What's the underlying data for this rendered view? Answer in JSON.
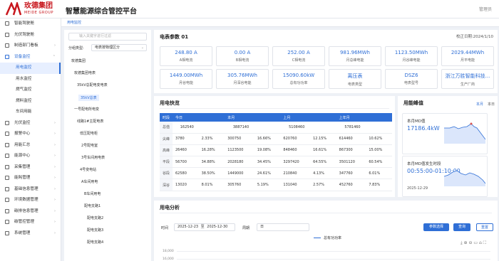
{
  "header": {
    "brand": "玫德集团",
    "brand_sub": "MEIDE GROUP",
    "title": "智慧能源综合管控平台",
    "user": "管理员"
  },
  "sidebar": {
    "items": [
      {
        "label": "智能驾驶舱",
        "icon": "cockpit-icon"
      },
      {
        "label": "光伏驾驶舱",
        "icon": "solar-icon"
      },
      {
        "label": "制造部门看板",
        "icon": "dashboard-icon"
      },
      {
        "label": "设备监控",
        "icon": "monitor-icon",
        "open": true
      },
      {
        "label": "用电监控",
        "sub": true,
        "active": true
      },
      {
        "label": "用水监控",
        "sub": true
      },
      {
        "label": "燃气监控",
        "sub": true
      },
      {
        "label": "燃料监控",
        "sub": true
      },
      {
        "label": "车间用能",
        "sub": true
      },
      {
        "label": "光伏监控",
        "icon": "sun-icon"
      },
      {
        "label": "报警中心",
        "icon": "alarm-icon"
      },
      {
        "label": "用能汇总",
        "icon": "summary-icon"
      },
      {
        "label": "能源中心",
        "icon": "energy-icon"
      },
      {
        "label": "采集管理",
        "icon": "collect-icon"
      },
      {
        "label": "能耗管理",
        "icon": "consumption-icon"
      },
      {
        "label": "基础信息管理",
        "icon": "info-icon"
      },
      {
        "label": "环境数据管理",
        "icon": "env-icon"
      },
      {
        "label": "碳排信息管理",
        "icon": "carbon-icon"
      },
      {
        "label": "碳管控管理",
        "icon": "control-icon"
      },
      {
        "label": "系统管理",
        "icon": "system-icon"
      }
    ]
  },
  "tabs": {
    "active": "用电监控"
  },
  "tree": {
    "search_placeholder": "输入关键字进行过滤",
    "filter_label": "分组类型:",
    "filter_value": "电表按物理区分",
    "nodes": [
      "玫德集团",
      "玫德集团电表",
      "35kV总配电变电表",
      "35kV总表",
      "一号配电所电变",
      "线路1#主配电表",
      "低压配电柜",
      "2号配电室",
      "3号车间用电表",
      "4号变电站",
      "A车间用电",
      "B车间用电",
      "配电支路1",
      "配电支路2",
      "配电支路3",
      "配电支路4"
    ]
  },
  "params": {
    "title": "电表参数 01",
    "updated": "校正日期:2024/1/10",
    "tiles": [
      {
        "value": "248.80 A",
        "label": "A相电流"
      },
      {
        "value": "0.00 A",
        "label": "B相电流"
      },
      {
        "value": "252.00 A",
        "label": "C相电流"
      },
      {
        "value": "981.96MWh",
        "label": "月总峰电能"
      },
      {
        "value": "1123.50MWh",
        "label": "月谷峰电能"
      },
      {
        "value": "2029.44MWh",
        "label": "月平电能"
      },
      {
        "value": "1449.00MWh",
        "label": "月谷电能"
      },
      {
        "value": "305.76MWh",
        "label": "月深谷电能"
      },
      {
        "value": "15090.60kW",
        "label": "总有功功率"
      },
      {
        "value": "离压表",
        "label": "电表类型"
      },
      {
        "value": "DSZ6",
        "label": "电表型号"
      },
      {
        "value": "浙江万胜智能科技...",
        "label": "生产厂商"
      }
    ]
  },
  "usage": {
    "title": "用电快览",
    "headers": [
      "时段",
      "今日",
      "",
      "本月",
      "",
      "上月",
      "",
      "上年月",
      ""
    ],
    "rows": [
      {
        "label": "总值",
        "cells": [
          "162540",
          "",
          "3887140",
          "",
          "5108460",
          "",
          "5781460",
          ""
        ]
      },
      {
        "label": "尖峰",
        "cells": [
          "3780",
          "2.33%",
          "300750",
          "16.66%",
          "620760",
          "12.15%",
          "614460",
          "10.62%"
        ]
      },
      {
        "label": "高峰",
        "cells": [
          "26460",
          "16.28%",
          "1123500",
          "19.08%",
          "848460",
          "16.61%",
          "867300",
          "15.00%"
        ]
      },
      {
        "label": "平段",
        "cells": [
          "56700",
          "34.88%",
          "2028180",
          "34.45%",
          "3297420",
          "64.55%",
          "3501120",
          "60.54%"
        ]
      },
      {
        "label": "谷段",
        "cells": [
          "62580",
          "38.50%",
          "1449000",
          "24.61%",
          "210840",
          "4.13%",
          "347760",
          "6.01%"
        ]
      },
      {
        "label": "深谷",
        "cells": [
          "13020",
          "8.01%",
          "305760",
          "5.19%",
          "131040",
          "2.57%",
          "452760",
          "7.83%"
        ]
      }
    ]
  },
  "peak": {
    "title": "用能峰值",
    "tab_month": "本月",
    "tab_year": "本日",
    "cards": [
      {
        "label": "本月MD值",
        "value": "17186.4kW",
        "date": ""
      },
      {
        "label": "本月MD值发生时段",
        "value": "00:55:00-01:10:00",
        "date": "2025-12-29"
      }
    ]
  },
  "analysis": {
    "title": "用电分析",
    "time_label": "时间",
    "date_start": "2025-12-23",
    "date_sep": "至",
    "date_end": "2025-12-30",
    "period_label": "周期",
    "period_value": "日",
    "btn_params": "参数选择",
    "btn_query": "查询",
    "btn_reset": "重置",
    "legend": "总有功功率",
    "y_top": "18,000",
    "y_next": "16,000"
  },
  "colors": {
    "accent": "#2f6fd6",
    "brand": "#c8161d"
  }
}
